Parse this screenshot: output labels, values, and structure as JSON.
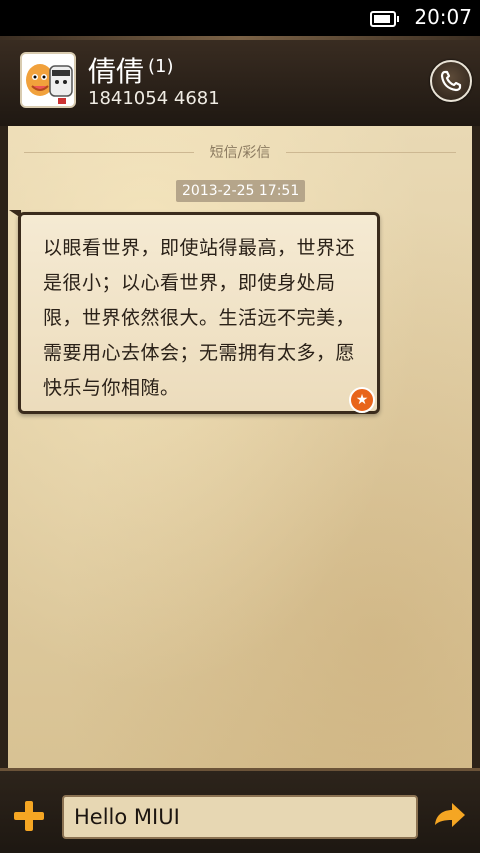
{
  "status_bar": {
    "time": "20:07",
    "battery_level": 0.9
  },
  "header": {
    "contact_name": "倩倩",
    "unread_count": "(1)",
    "phone_number": "1841054 4681",
    "call_icon": "phone-icon"
  },
  "thread": {
    "type_label": "短信/彩信",
    "timestamp": "2013-2-25 17:51",
    "messages": [
      {
        "text": "以眼看世界，即使站得最高，世界还是很小；以心看世界，即使身处局限，世界依然很大。生活远不完美，需要用心去体会；无需拥有太多，愿快乐与你相随。",
        "starred": true,
        "star_icon": "star-icon"
      }
    ]
  },
  "compose": {
    "value": "Hello MIUI",
    "add_icon": "plus-icon",
    "send_icon": "send-arrow-icon"
  },
  "colors": {
    "accent": "#f5a623",
    "star": "#e8641a",
    "paper": "#e9d9b4"
  }
}
